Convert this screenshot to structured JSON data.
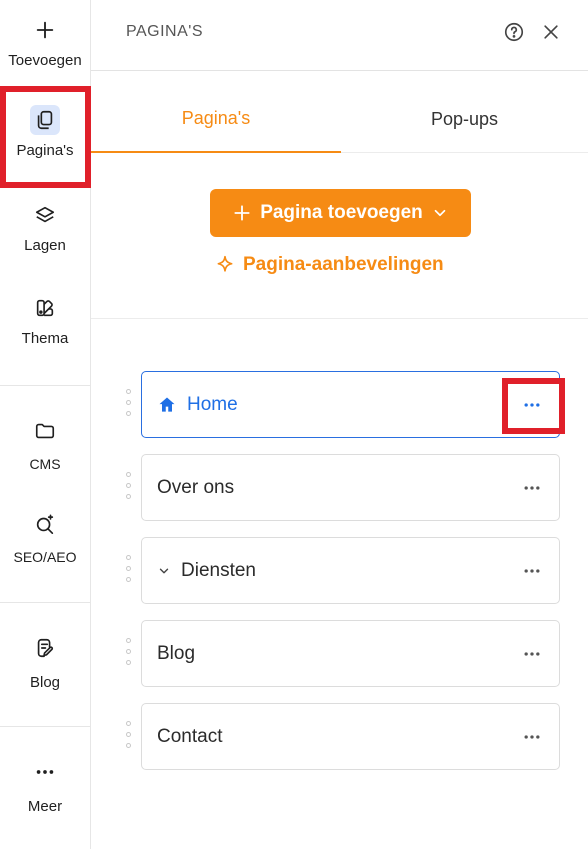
{
  "sidebar": {
    "items": [
      {
        "label": "Toevoegen",
        "icon": "plus-icon"
      },
      {
        "label": "Pagina's",
        "icon": "pages-icon"
      },
      {
        "label": "Lagen",
        "icon": "layers-icon"
      },
      {
        "label": "Thema",
        "icon": "theme-icon"
      },
      {
        "label": "CMS",
        "icon": "folder-icon"
      },
      {
        "label": "SEO/AEO",
        "icon": "seo-search-icon"
      },
      {
        "label": "Blog",
        "icon": "blog-icon"
      },
      {
        "label": "Meer",
        "icon": "more-icon"
      }
    ],
    "active_item": "Pagina's"
  },
  "panel": {
    "title": "PAGINA'S",
    "help_icon": "help-icon",
    "close_icon": "close-icon",
    "tabs": [
      {
        "label": "Pagina's",
        "active": true
      },
      {
        "label": "Pop-ups",
        "active": false
      }
    ],
    "add_button": "Pagina toevoegen",
    "recommendations_link": "Pagina-aanbevelingen"
  },
  "pages": [
    {
      "label": "Home",
      "icon": "home-icon",
      "selected": true
    },
    {
      "label": "Over ons"
    },
    {
      "label": "Diensten",
      "icon": "chevron-down-icon"
    },
    {
      "label": "Blog"
    },
    {
      "label": "Contact"
    }
  ],
  "colors": {
    "accent": "#f68b14",
    "selected": "#1f6fe5",
    "highlight": "#e0202a",
    "active_icon_bg": "#dbe6fb"
  }
}
